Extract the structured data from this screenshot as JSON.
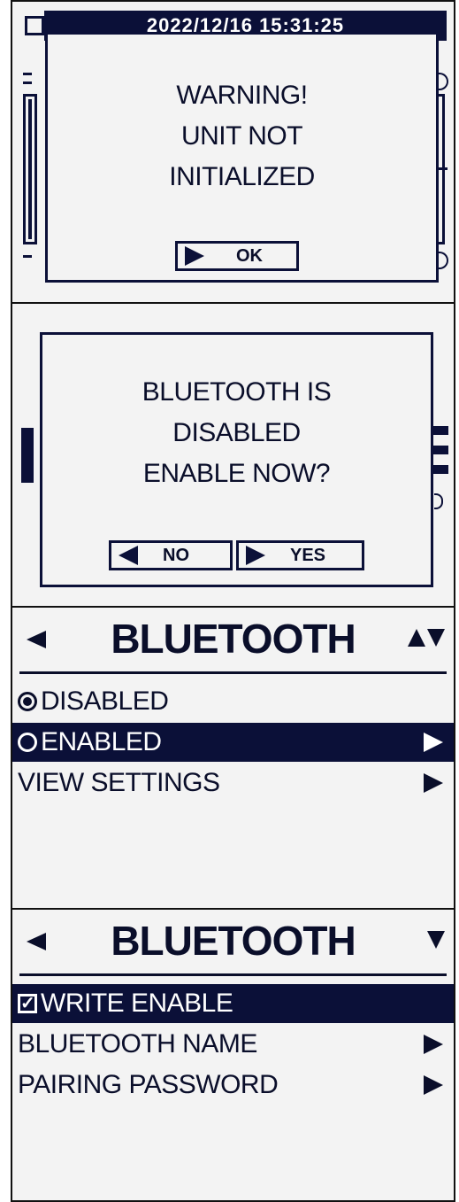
{
  "screen1": {
    "datetime": "2022/12/16 15:31:25",
    "dialog": {
      "line1": "WARNING!",
      "line2": "UNIT NOT",
      "line3": "INITIALIZED",
      "ok_label": "OK"
    }
  },
  "screen2": {
    "dialog": {
      "line1": "BLUETOOTH IS",
      "line2": "DISABLED",
      "line3": "ENABLE NOW?",
      "no_label": "NO",
      "yes_label": "YES"
    }
  },
  "screen3": {
    "title": "BLUETOOTH",
    "items": [
      {
        "label": "DISABLED",
        "type": "radio",
        "checked": true,
        "selected": false
      },
      {
        "label": "ENABLED",
        "type": "radio",
        "checked": false,
        "selected": true
      },
      {
        "label": "VIEW SETTINGS",
        "type": "submenu",
        "selected": false
      }
    ]
  },
  "screen4": {
    "title": "BLUETOOTH",
    "items": [
      {
        "label": "WRITE ENABLE",
        "type": "checkbox",
        "checked": true,
        "selected": true
      },
      {
        "label": "BLUETOOTH NAME",
        "type": "submenu",
        "selected": false
      },
      {
        "label": "PAIRING PASSWORD",
        "type": "submenu",
        "selected": false
      }
    ]
  },
  "colors": {
    "dark": "#0b1038",
    "screen_bg": "#f3f3f3"
  }
}
